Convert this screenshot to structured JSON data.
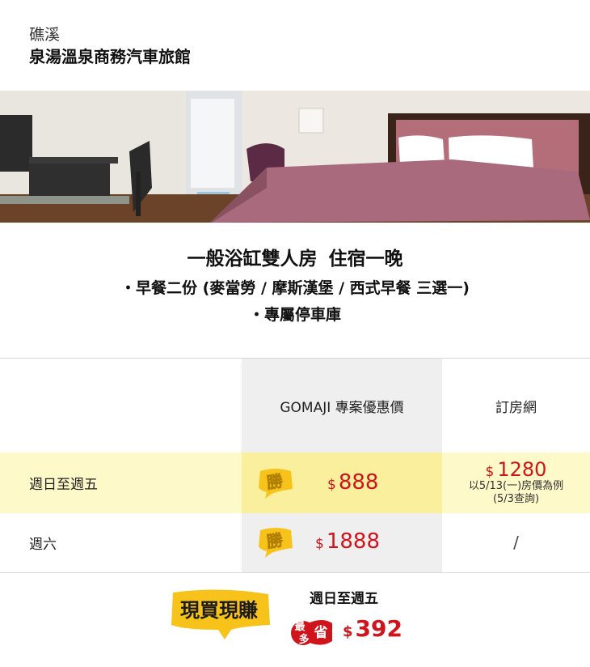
{
  "header": {
    "location": "礁溪",
    "hotel_name": "泉湯溫泉商務汽車旅館"
  },
  "room": {
    "title_main": "一般浴缸雙人房",
    "title_sub": "住宿一晚",
    "features": [
      "・早餐二份 (麥當勞 / 摩斯漢堡 / 西式早餐 三選一)",
      "・專屬停車庫"
    ]
  },
  "table": {
    "headers": {
      "gomaji": "GOMAJI 專案優惠價",
      "booking": "訂房網"
    },
    "win_badge_text": "勝",
    "rows": [
      {
        "label": "週日至週五",
        "gomaji_currency": "$",
        "gomaji_price": "888",
        "booking_currency": "$",
        "booking_price": "1280",
        "booking_note_1": "以5/13(一)房價為例",
        "booking_note_2": "(5/3查詢)"
      },
      {
        "label": "週六",
        "gomaji_currency": "$",
        "gomaji_price": "1888",
        "booking_value": "/"
      }
    ]
  },
  "savings": {
    "logo_text": "現買現賺",
    "period": "週日至週五",
    "badge_text_1": "最",
    "badge_text_2": "多",
    "badge_text_3": "省",
    "currency": "$",
    "amount": "392"
  },
  "colors": {
    "price_red": "#d0141b",
    "highlight_row": "#fdf9c8",
    "highlight_gomaji": "#f9ef9c",
    "gomaji_col": "#efefef",
    "badge_yellow": "#f7c31a"
  }
}
